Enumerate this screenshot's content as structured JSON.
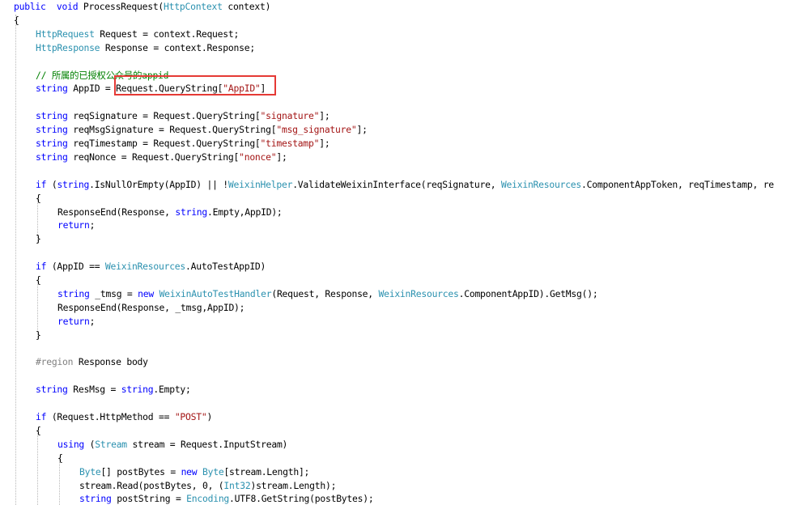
{
  "colors": {
    "keyword": "#0000ff",
    "type": "#2b91af",
    "string": "#a31515",
    "comment": "#008000",
    "preprocessor": "#808080",
    "plain": "#000000",
    "highlight_border": "#e53935"
  },
  "code": {
    "lines": [
      {
        "indent": 0,
        "tokens": [
          [
            "kw",
            "public"
          ],
          [
            "",
            "  "
          ],
          [
            "kw",
            "void"
          ],
          [
            "",
            " ProcessRequest("
          ],
          [
            "ty",
            "HttpContext"
          ],
          [
            "",
            " context)"
          ]
        ]
      },
      {
        "indent": 0,
        "tokens": [
          [
            "",
            "{"
          ]
        ]
      },
      {
        "indent": 1,
        "tokens": [
          [
            "ty",
            "HttpRequest"
          ],
          [
            "",
            " Request = context.Request;"
          ]
        ]
      },
      {
        "indent": 1,
        "tokens": [
          [
            "ty",
            "HttpResponse"
          ],
          [
            "",
            " Response = context.Response;"
          ]
        ]
      },
      {
        "indent": 1,
        "tokens": []
      },
      {
        "indent": 1,
        "tokens": [
          [
            "cm",
            "// 所属的已授权公众号的appid"
          ]
        ]
      },
      {
        "indent": 1,
        "tokens": [
          [
            "kw",
            "string"
          ],
          [
            "",
            " AppID = Request.QueryString["
          ],
          [
            "st",
            "\"AppID\""
          ],
          [
            "",
            "]"
          ]
        ]
      },
      {
        "indent": 1,
        "tokens": []
      },
      {
        "indent": 1,
        "tokens": [
          [
            "kw",
            "string"
          ],
          [
            "",
            " reqSignature = Request.QueryString["
          ],
          [
            "st",
            "\"signature\""
          ],
          [
            "",
            "];"
          ]
        ]
      },
      {
        "indent": 1,
        "tokens": [
          [
            "kw",
            "string"
          ],
          [
            "",
            " reqMsgSignature = Request.QueryString["
          ],
          [
            "st",
            "\"msg_signature\""
          ],
          [
            "",
            "];"
          ]
        ]
      },
      {
        "indent": 1,
        "tokens": [
          [
            "kw",
            "string"
          ],
          [
            "",
            " reqTimestamp = Request.QueryString["
          ],
          [
            "st",
            "\"timestamp\""
          ],
          [
            "",
            "];"
          ]
        ]
      },
      {
        "indent": 1,
        "tokens": [
          [
            "kw",
            "string"
          ],
          [
            "",
            " reqNonce = Request.QueryString["
          ],
          [
            "st",
            "\"nonce\""
          ],
          [
            "",
            "];"
          ]
        ]
      },
      {
        "indent": 1,
        "tokens": []
      },
      {
        "indent": 1,
        "tokens": [
          [
            "kw",
            "if"
          ],
          [
            "",
            " ("
          ],
          [
            "kw",
            "string"
          ],
          [
            "",
            ".IsNullOrEmpty(AppID) || !"
          ],
          [
            "ty",
            "WeixinHelper"
          ],
          [
            "",
            ".ValidateWeixinInterface(reqSignature, "
          ],
          [
            "ty",
            "WeixinResources"
          ],
          [
            "",
            ".ComponentAppToken, reqTimestamp, re"
          ]
        ]
      },
      {
        "indent": 1,
        "tokens": [
          [
            "",
            "{"
          ]
        ]
      },
      {
        "indent": 2,
        "tokens": [
          [
            "",
            "ResponseEnd(Response, "
          ],
          [
            "kw",
            "string"
          ],
          [
            "",
            ".Empty,AppID);"
          ]
        ]
      },
      {
        "indent": 2,
        "tokens": [
          [
            "kw",
            "return"
          ],
          [
            "",
            ";"
          ]
        ]
      },
      {
        "indent": 1,
        "tokens": [
          [
            "",
            "}"
          ]
        ]
      },
      {
        "indent": 1,
        "tokens": []
      },
      {
        "indent": 1,
        "tokens": [
          [
            "kw",
            "if"
          ],
          [
            "",
            " (AppID == "
          ],
          [
            "ty",
            "WeixinResources"
          ],
          [
            "",
            ".AutoTestAppID)"
          ]
        ]
      },
      {
        "indent": 1,
        "tokens": [
          [
            "",
            "{"
          ]
        ]
      },
      {
        "indent": 2,
        "tokens": [
          [
            "kw",
            "string"
          ],
          [
            "",
            " _tmsg = "
          ],
          [
            "kw",
            "new"
          ],
          [
            "",
            " "
          ],
          [
            "ty",
            "WeixinAutoTestHandler"
          ],
          [
            "",
            "(Request, Response, "
          ],
          [
            "ty",
            "WeixinResources"
          ],
          [
            "",
            ".ComponentAppID).GetMsg();"
          ]
        ]
      },
      {
        "indent": 2,
        "tokens": [
          [
            "",
            "ResponseEnd(Response, _tmsg,AppID);"
          ]
        ]
      },
      {
        "indent": 2,
        "tokens": [
          [
            "kw",
            "return"
          ],
          [
            "",
            ";"
          ]
        ]
      },
      {
        "indent": 1,
        "tokens": [
          [
            "",
            "}"
          ]
        ]
      },
      {
        "indent": 1,
        "tokens": []
      },
      {
        "indent": 1,
        "tokens": [
          [
            "pp",
            "#region"
          ],
          [
            "",
            " Response body"
          ]
        ]
      },
      {
        "indent": 1,
        "tokens": []
      },
      {
        "indent": 1,
        "tokens": [
          [
            "kw",
            "string"
          ],
          [
            "",
            " ResMsg = "
          ],
          [
            "kw",
            "string"
          ],
          [
            "",
            ".Empty;"
          ]
        ]
      },
      {
        "indent": 1,
        "tokens": []
      },
      {
        "indent": 1,
        "tokens": [
          [
            "kw",
            "if"
          ],
          [
            "",
            " (Request.HttpMethod == "
          ],
          [
            "st",
            "\"POST\""
          ],
          [
            "",
            ")"
          ]
        ]
      },
      {
        "indent": 1,
        "tokens": [
          [
            "",
            "{"
          ]
        ]
      },
      {
        "indent": 2,
        "tokens": [
          [
            "kw",
            "using"
          ],
          [
            "",
            " ("
          ],
          [
            "ty",
            "Stream"
          ],
          [
            "",
            " stream = Request.InputStream)"
          ]
        ]
      },
      {
        "indent": 2,
        "tokens": [
          [
            "",
            "{"
          ]
        ]
      },
      {
        "indent": 3,
        "tokens": [
          [
            "ty",
            "Byte"
          ],
          [
            "",
            "[] postBytes = "
          ],
          [
            "kw",
            "new"
          ],
          [
            "",
            " "
          ],
          [
            "ty",
            "Byte"
          ],
          [
            "",
            "[stream.Length];"
          ]
        ]
      },
      {
        "indent": 3,
        "tokens": [
          [
            "",
            "stream.Read(postBytes, 0, ("
          ],
          [
            "ty",
            "Int32"
          ],
          [
            "",
            ")stream.Length);"
          ]
        ]
      },
      {
        "indent": 3,
        "tokens": [
          [
            "kw",
            "string"
          ],
          [
            "",
            " postString = "
          ],
          [
            "ty",
            "Encoding"
          ],
          [
            "",
            ".UTF8.GetString(postBytes);"
          ]
        ]
      }
    ]
  }
}
